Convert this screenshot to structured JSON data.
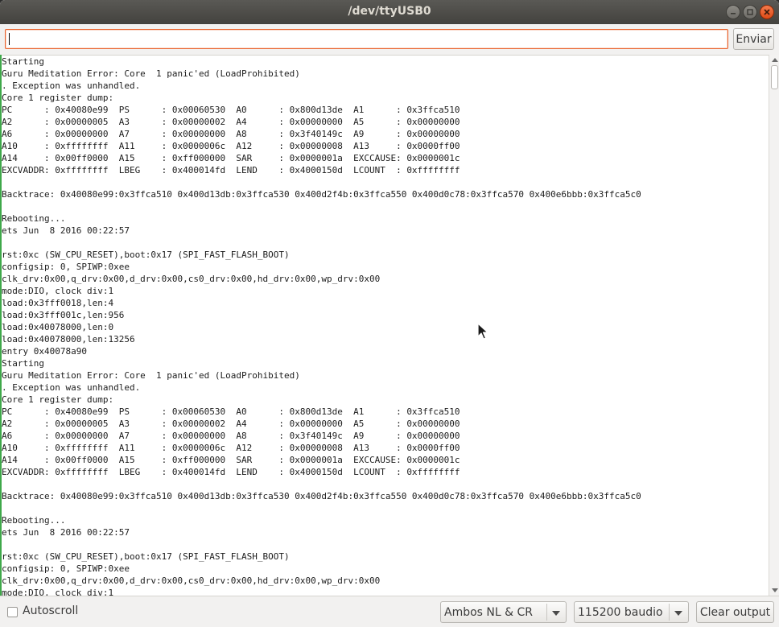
{
  "window": {
    "title": "/dev/ttyUSB0"
  },
  "send": {
    "input_value": "",
    "button_label": "Enviar"
  },
  "output": {
    "lines": [
      "Starting",
      "Guru Meditation Error: Core  1 panic'ed (LoadProhibited)",
      ". Exception was unhandled.",
      "Core 1 register dump:",
      "PC      : 0x40080e99  PS      : 0x00060530  A0      : 0x800d13de  A1      : 0x3ffca510",
      "A2      : 0x00000005  A3      : 0x00000002  A4      : 0x00000000  A5      : 0x00000000",
      "A6      : 0x00000000  A7      : 0x00000000  A8      : 0x3f40149c  A9      : 0x00000000",
      "A10     : 0xffffffff  A11     : 0x0000006c  A12     : 0x00000008  A13     : 0x0000ff00",
      "A14     : 0x00ff0000  A15     : 0xff000000  SAR     : 0x0000001a  EXCCAUSE: 0x0000001c",
      "EXCVADDR: 0xffffffff  LBEG    : 0x400014fd  LEND    : 0x4000150d  LCOUNT  : 0xffffffff",
      "",
      "Backtrace: 0x40080e99:0x3ffca510 0x400d13db:0x3ffca530 0x400d2f4b:0x3ffca550 0x400d0c78:0x3ffca570 0x400e6bbb:0x3ffca5c0",
      "",
      "Rebooting...",
      "ets Jun  8 2016 00:22:57",
      "",
      "rst:0xc (SW_CPU_RESET),boot:0x17 (SPI_FAST_FLASH_BOOT)",
      "configsip: 0, SPIWP:0xee",
      "clk_drv:0x00,q_drv:0x00,d_drv:0x00,cs0_drv:0x00,hd_drv:0x00,wp_drv:0x00",
      "mode:DIO, clock div:1",
      "load:0x3fff0018,len:4",
      "load:0x3fff001c,len:956",
      "load:0x40078000,len:0",
      "load:0x40078000,len:13256",
      "entry 0x40078a90",
      "Starting",
      "Guru Meditation Error: Core  1 panic'ed (LoadProhibited)",
      ". Exception was unhandled.",
      "Core 1 register dump:",
      "PC      : 0x40080e99  PS      : 0x00060530  A0      : 0x800d13de  A1      : 0x3ffca510",
      "A2      : 0x00000005  A3      : 0x00000002  A4      : 0x00000000  A5      : 0x00000000",
      "A6      : 0x00000000  A7      : 0x00000000  A8      : 0x3f40149c  A9      : 0x00000000",
      "A10     : 0xffffffff  A11     : 0x0000006c  A12     : 0x00000008  A13     : 0x0000ff00",
      "A14     : 0x00ff0000  A15     : 0xff000000  SAR     : 0x0000001a  EXCCAUSE: 0x0000001c",
      "EXCVADDR: 0xffffffff  LBEG    : 0x400014fd  LEND    : 0x4000150d  LCOUNT  : 0xffffffff",
      "",
      "Backtrace: 0x40080e99:0x3ffca510 0x400d13db:0x3ffca530 0x400d2f4b:0x3ffca550 0x400d0c78:0x3ffca570 0x400e6bbb:0x3ffca5c0",
      "",
      "Rebooting...",
      "ets Jun  8 2016 00:22:57",
      "",
      "rst:0xc (SW_CPU_RESET),boot:0x17 (SPI_FAST_FLASH_BOOT)",
      "configsip: 0, SPIWP:0xee",
      "clk_drv:0x00,q_drv:0x00,d_drv:0x00,cs0_drv:0x00,hd_drv:0x00,wp_drv:0x00",
      "mode:DIO, clock div:1"
    ]
  },
  "bottom": {
    "autoscroll_label": "Autoscroll",
    "autoscroll_checked": false,
    "line_ending": "Ambos NL & CR",
    "baud_rate": "115200 baudio",
    "clear_label": "Clear output"
  },
  "colors": {
    "titlebar": "#4a4945",
    "accent_focus": "#e9622c",
    "close_button": "#e95420"
  }
}
